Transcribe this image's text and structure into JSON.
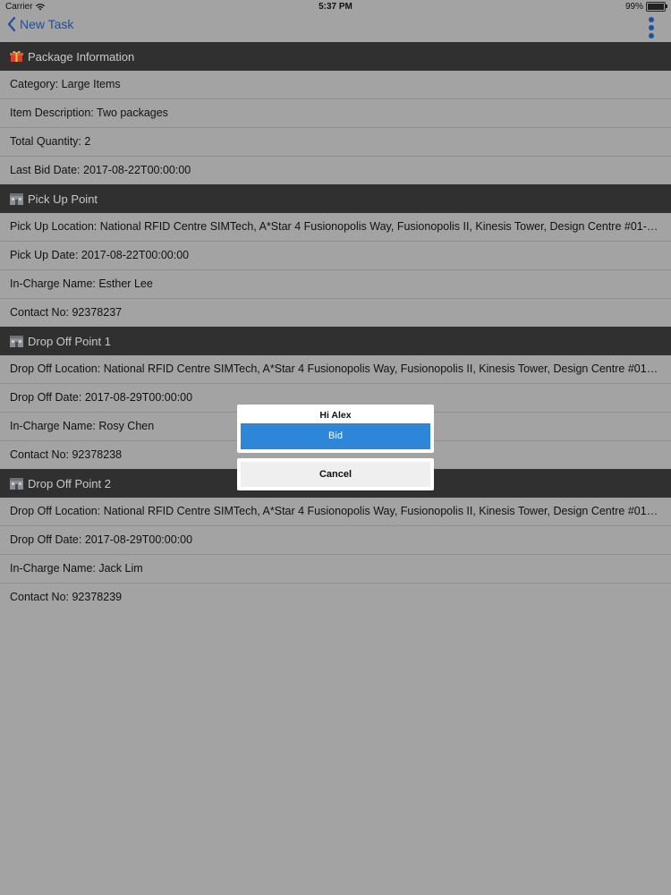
{
  "status_bar": {
    "carrier": "Carrier",
    "time": "5:37 PM",
    "battery": "99%"
  },
  "nav": {
    "back_label": "New Task"
  },
  "sections": [
    {
      "title": "Package Information",
      "icon": "gift-icon",
      "rows": [
        "Category: Large Items",
        "Item Description: Two packages",
        "Total Quantity: 2",
        "Last Bid Date: 2017-08-22T00:00:00"
      ]
    },
    {
      "title": "Pick Up Point",
      "icon": "building-icon",
      "rows": [
        "Pick Up Location: National RFID Centre SIMTech, A*Star 4 Fusionopolis Way, Fusionopolis II, Kinesis Tower, Design Centre #01-0...",
        "Pick Up Date: 2017-08-22T00:00:00",
        "In-Charge Name: Esther Lee",
        "Contact No: 92378237"
      ]
    },
    {
      "title": "Drop Off Point 1",
      "icon": "building-icon",
      "rows": [
        "Drop Off Location: National RFID Centre SIMTech, A*Star 4 Fusionopolis Way, Fusionopolis II, Kinesis Tower, Design Centre #01-...",
        "Drop Off Date: 2017-08-29T00:00:00",
        "In-Charge Name: Rosy Chen",
        "Contact No: 92378238"
      ]
    },
    {
      "title": "Drop Off Point 2",
      "icon": "building-icon",
      "rows": [
        "Drop Off Location: National RFID Centre SIMTech, A*Star 4 Fusionopolis Way, Fusionopolis II, Kinesis Tower, Design Centre #01-...",
        "Drop Off Date: 2017-08-29T00:00:00",
        "In-Charge Name: Jack Lim",
        "Contact No: 92378239"
      ]
    }
  ],
  "action_sheet": {
    "title": "Hi Alex",
    "bid_label": "Bid",
    "cancel_label": "Cancel"
  },
  "colors": {
    "accent": "#2e86d9",
    "nav_tint": "#1f4fa0",
    "header_bg": "#303030"
  }
}
